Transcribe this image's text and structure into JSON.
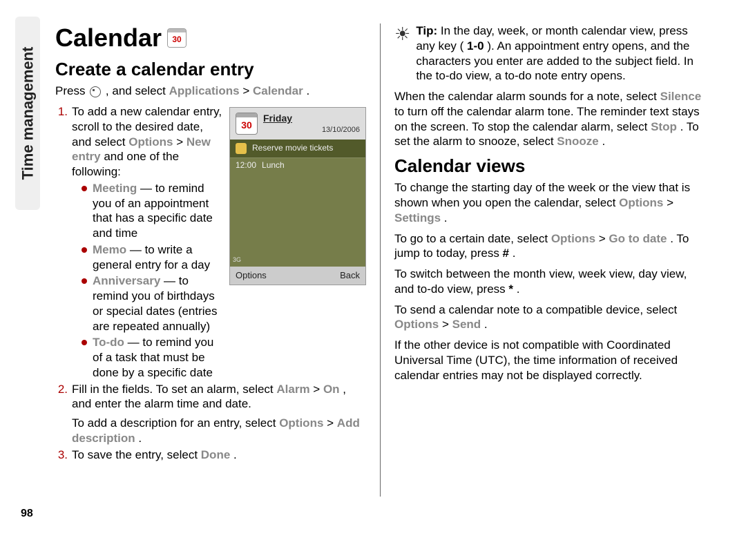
{
  "side_label": "Time management",
  "page_number": "98",
  "left": {
    "title": "Calendar",
    "title_icon_day": "30",
    "subtitle": "Create a calendar entry",
    "press_pre": "Press ",
    "press_post": " , and select ",
    "press_menu1": "Applications",
    "press_gt": " > ",
    "press_menu2": "Calendar",
    "press_end": ".",
    "step1": {
      "num": "1.",
      "a": "To add a new calendar entry, scroll to the desired date, and select ",
      "m1": "Options",
      "gt": " > ",
      "m2": "New entry",
      "b": " and one of the following:"
    },
    "bullets": [
      {
        "m": "Meeting",
        "t": " — to remind you of an appointment that has a specific date and time"
      },
      {
        "m": "Memo",
        "t": " — to write a general entry for a day"
      },
      {
        "m": "Anniversary",
        "t": " — to remind you of birthdays or special dates (entries are repeated annually)"
      },
      {
        "m": "To-do",
        "t": " — to remind you of a task that must be done by a specific date"
      }
    ],
    "step2": {
      "num": "2.",
      "a": "Fill in the fields. To set an alarm, select ",
      "m1": "Alarm",
      "gt": " > ",
      "m2": "On",
      "b": ", and enter the alarm time and date.",
      "c": "To add a description for an entry, select ",
      "m3": "Options",
      "gt2": " > ",
      "m4": "Add description",
      "d": "."
    },
    "step3": {
      "num": "3.",
      "a": "To save the entry, select ",
      "m1": "Done",
      "b": "."
    },
    "screenshot": {
      "icon_day": "30",
      "dayname": "Friday",
      "date": "13/10/2006",
      "row1": "Reserve movie tickets",
      "row2_time": "12:00",
      "row2_text": "Lunch",
      "left_soft": "Options",
      "right_soft": "Back",
      "signal": "3G"
    }
  },
  "right": {
    "tip": {
      "label": "Tip:",
      "a": " In the day, week, or month calendar view, press any key (",
      "keys": "1-0",
      "b": "). An appointment entry opens, and the characters you enter are added to the subject field. In the to-do view, a to-do note entry opens."
    },
    "p1": {
      "a": "When the calendar alarm sounds for a note, select ",
      "m1": "Silence",
      "b": " to turn off the calendar alarm tone. The reminder text stays on the screen. To stop the calendar alarm, select ",
      "m2": "Stop",
      "c": ". To set the alarm to snooze, select ",
      "m3": "Snooze",
      "d": "."
    },
    "subtitle": "Calendar views",
    "p2": {
      "a": "To change the starting day of the week or the view that is shown when you open the calendar, select ",
      "m1": "Options",
      "gt": " > ",
      "m2": "Settings",
      "b": "."
    },
    "p3": {
      "a": "To go to a certain date, select ",
      "m1": "Options",
      "gt": " > ",
      "m2": "Go to date",
      "b": ". To jump to today, press ",
      "key": "#",
      "c": "."
    },
    "p4": {
      "a": "To switch between the month view, week view, day view, and to-do view, press ",
      "key": "*",
      "b": "."
    },
    "p5": {
      "a": "To send a calendar note to a compatible device, select ",
      "m1": "Options",
      "gt": " > ",
      "m2": "Send",
      "b": "."
    },
    "p6": "If the other device is not compatible with Coordinated Universal Time (UTC), the time information of received calendar entries may not be displayed correctly."
  }
}
